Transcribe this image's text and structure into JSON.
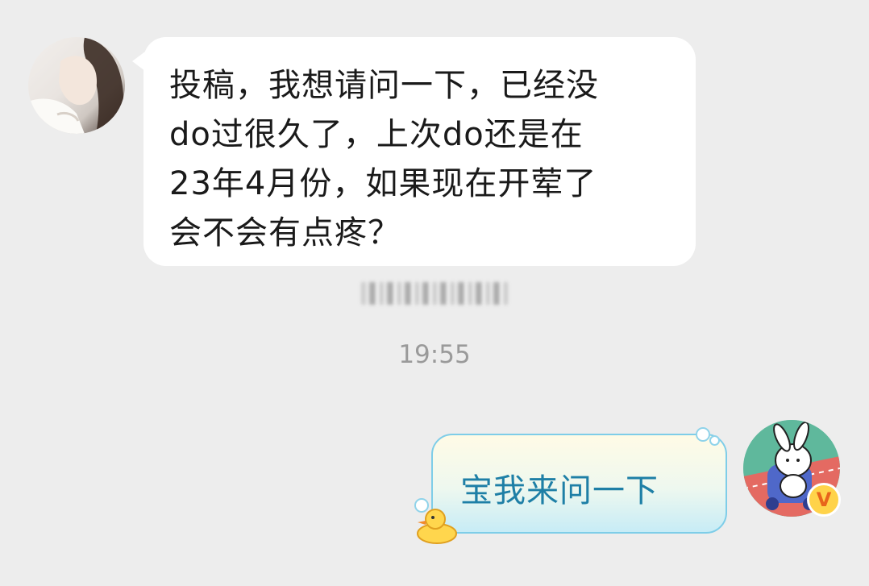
{
  "incoming_message": {
    "text": "投稿，我想请问一下，已经没\ndo过很久了，上次do还是在\n23年4月份，如果现在开荤了\n会不会有点疼？"
  },
  "timestamp": "19:55",
  "outgoing_message": {
    "text": "宝我来问一下"
  },
  "verified_badge": "V",
  "colors": {
    "background": "#ededed",
    "incoming_bubble": "#ffffff",
    "outgoing_text": "#1e7fa6",
    "outgoing_border": "#7ecde8",
    "timestamp": "#9a9a9a"
  },
  "icons": [
    "user-avatar-photo",
    "bunny-scooter-avatar",
    "verified-badge-icon",
    "duck-sticker-icon"
  ]
}
